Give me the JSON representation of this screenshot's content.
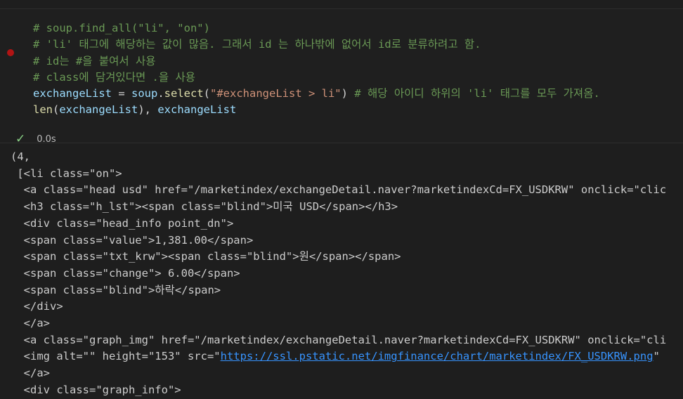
{
  "cell": {
    "code_lines": [
      [
        {
          "t": "# soup.find_all(\"li\", \"on\")",
          "c": "cm"
        }
      ],
      [
        {
          "t": "# 'li' 태그에 해당하는 값이 많음. 그래서 id 는 하나밖에 없어서 id로 분류하려고 함.",
          "c": "cm"
        }
      ],
      [
        {
          "t": "# id는 #을 붙여서 사용",
          "c": "cm"
        }
      ],
      [
        {
          "t": "# class에 담겨있다면 .을 사용",
          "c": "cm"
        }
      ],
      [
        {
          "t": "exchangeList",
          "c": "var"
        },
        {
          "t": " = ",
          "c": "op"
        },
        {
          "t": "soup",
          "c": "var"
        },
        {
          "t": ".",
          "c": "op"
        },
        {
          "t": "select",
          "c": "fn"
        },
        {
          "t": "(",
          "c": "op"
        },
        {
          "t": "\"#exchangeList > li\"",
          "c": "str"
        },
        {
          "t": ") ",
          "c": "op"
        },
        {
          "t": "# 해당 아이디 하위의 'li' 태그를 모두 가져옴.",
          "c": "cm"
        }
      ],
      [
        {
          "t": "len",
          "c": "fn"
        },
        {
          "t": "(",
          "c": "op"
        },
        {
          "t": "exchangeList",
          "c": "var"
        },
        {
          "t": "), ",
          "c": "op"
        },
        {
          "t": "exchangeList",
          "c": "var"
        }
      ]
    ],
    "status_icon": "check-icon",
    "exec_time": "0.0s"
  },
  "output_lines": [
    [
      {
        "t": "(4,"
      }
    ],
    [
      {
        "t": " [<li class=\"on\">"
      }
    ],
    [
      {
        "t": "  <a class=\"head usd\" href=\"/marketindex/exchangeDetail.naver?marketindexCd=FX_USDKRW\" onclick=\"clic"
      }
    ],
    [
      {
        "t": "  <h3 class=\"h_lst\"><span class=\"blind\">미국 USD</span></h3>"
      }
    ],
    [
      {
        "t": "  <div class=\"head_info point_dn\">"
      }
    ],
    [
      {
        "t": "  <span class=\"value\">1,381.00</span>"
      }
    ],
    [
      {
        "t": "  <span class=\"txt_krw\"><span class=\"blind\">원</span></span>"
      }
    ],
    [
      {
        "t": "  <span class=\"change\"> 6.00</span>"
      }
    ],
    [
      {
        "t": "  <span class=\"blind\">하락</span>"
      }
    ],
    [
      {
        "t": "  </div>"
      }
    ],
    [
      {
        "t": "  </a>"
      }
    ],
    [
      {
        "t": "  <a class=\"graph_img\" href=\"/marketindex/exchangeDetail.naver?marketindexCd=FX_USDKRW\" onclick=\"cli"
      }
    ],
    [
      {
        "t": "  <img alt=\"\" height=\"153\" src=\""
      },
      {
        "t": "https://ssl.pstatic.net/imgfinance/chart/marketindex/FX_USDKRW.png",
        "c": "link"
      },
      {
        "t": "\""
      }
    ],
    [
      {
        "t": "  </a>"
      }
    ],
    [
      {
        "t": "  <div class=\"graph_info\">"
      }
    ]
  ]
}
